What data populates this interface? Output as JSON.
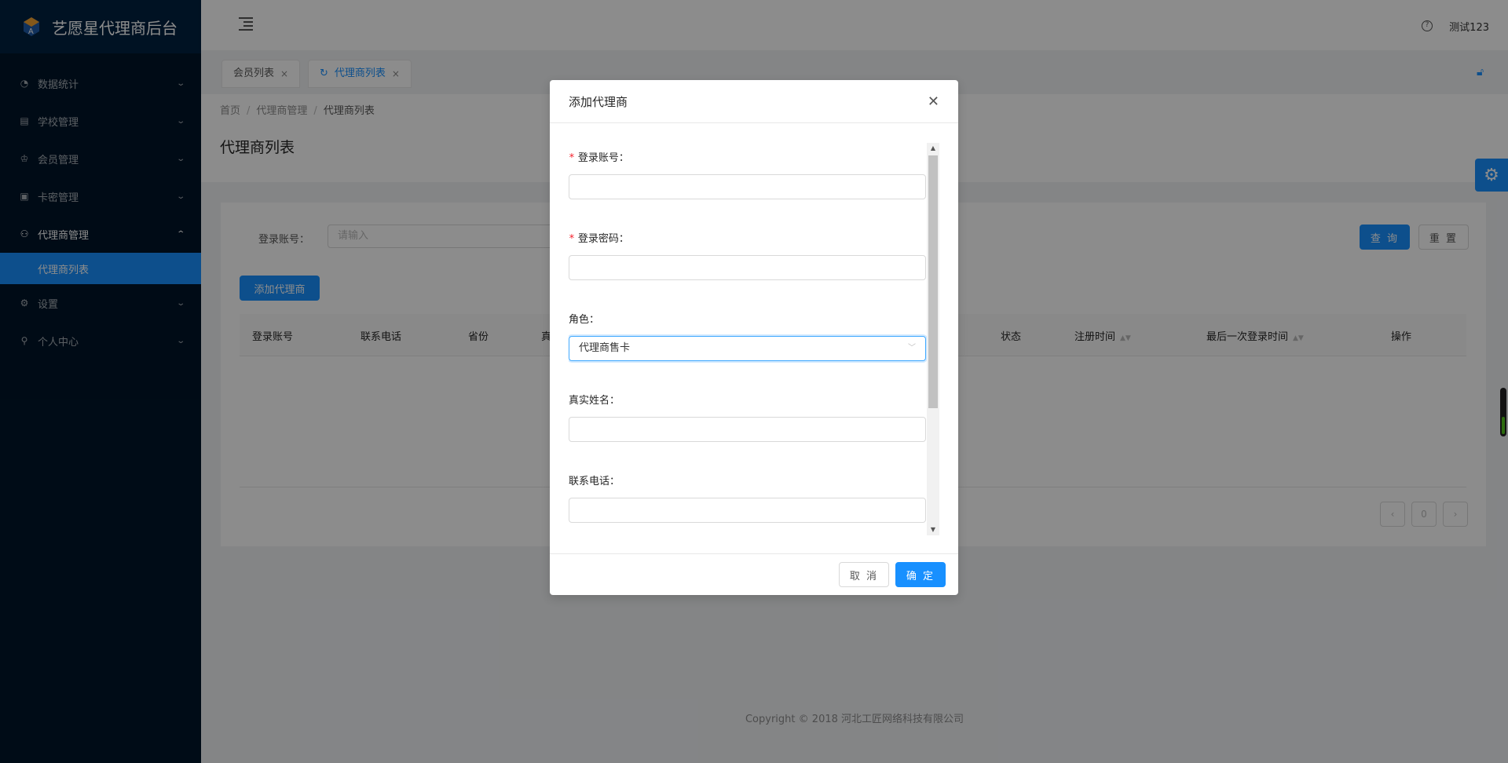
{
  "app": {
    "title": "艺愿星代理商后台",
    "brand_color": "#1890ff",
    "sidebar_bg": "#001529"
  },
  "sidebar": {
    "items": [
      {
        "label": "数据统计",
        "icon": "dashboard-icon",
        "arrow": "chevron-down-icon"
      },
      {
        "label": "学校管理",
        "icon": "book-icon",
        "arrow": "chevron-down-icon"
      },
      {
        "label": "会员管理",
        "icon": "crown-icon",
        "arrow": "chevron-down-icon"
      },
      {
        "label": "卡密管理",
        "icon": "card-icon",
        "arrow": "chevron-down-icon"
      },
      {
        "label": "代理商管理",
        "icon": "team-icon",
        "arrow": "chevron-up-icon"
      },
      {
        "label": "设置",
        "icon": "gear-icon",
        "arrow": "chevron-down-icon"
      },
      {
        "label": "个人中心",
        "icon": "user-icon",
        "arrow": "chevron-down-icon"
      }
    ],
    "active_sub": "代理商列表"
  },
  "header": {
    "user": "测试123"
  },
  "tabs": [
    {
      "label": "会员列表"
    },
    {
      "label": "代理商列表"
    }
  ],
  "page": {
    "breadcrumb": [
      "首页",
      "代理商管理",
      "代理商列表"
    ],
    "title": "代理商列表"
  },
  "filter": {
    "label": "登录账号：",
    "placeholder": "请输入",
    "query_button": "查 询",
    "reset_button": "重 置"
  },
  "add_button": "添加代理商",
  "table": {
    "columns": [
      "登录账号",
      "联系电话",
      "省份",
      "真",
      "状态",
      "注册时间",
      "最后一次登录时间",
      "操作"
    ],
    "page": "0"
  },
  "footer": {
    "copyright": "Copyright",
    "text": "2018 河北工匠网络科技有限公司"
  },
  "modal": {
    "title": "添加代理商",
    "fields": [
      {
        "label": "登录账号：",
        "required": true,
        "value": ""
      },
      {
        "label": "登录密码：",
        "required": true,
        "value": ""
      },
      {
        "label": "角色：",
        "required": false,
        "value": "代理商售卡"
      },
      {
        "label": "真实姓名：",
        "required": false,
        "value": ""
      },
      {
        "label": "联系电话：",
        "required": false,
        "value": ""
      }
    ],
    "cancel_button": "取 消",
    "ok_button": "确 定"
  }
}
